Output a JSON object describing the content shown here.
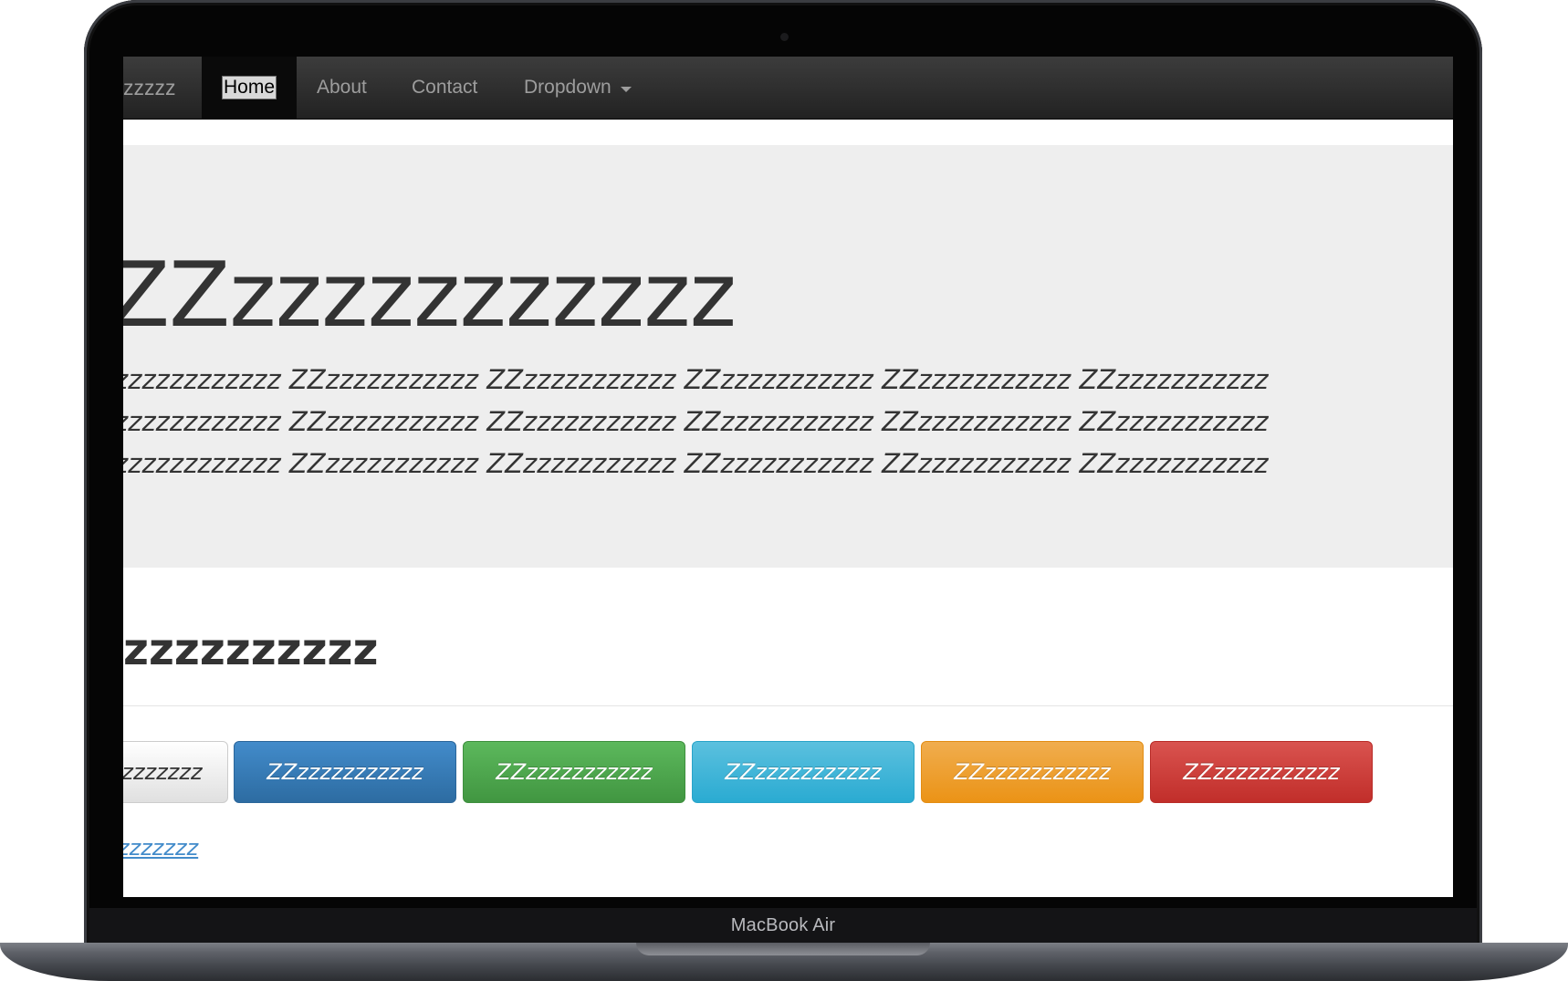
{
  "device": {
    "model_label": "MacBook Air"
  },
  "navbar": {
    "brand": "zzzzz",
    "items": [
      {
        "label": "Home",
        "active": true
      },
      {
        "label": "About"
      },
      {
        "label": "Contact"
      },
      {
        "label": "Dropdown",
        "has_caret": true
      }
    ]
  },
  "jumbotron": {
    "title": "ZZzzzzzzzzzzz",
    "lines": [
      "zzzzzzzzzzzz ZZzzzzzzzzzzz ZZzzzzzzzzzzz ZZzzzzzzzzzzz ZZzzzzzzzzzzz ZZzzzzzzzzzzz",
      "zzzzzzzzzzzz ZZzzzzzzzzzzz ZZzzzzzzzzzzz ZZzzzzzzzzzzz ZZzzzzzzzzzzz ZZzzzzzzzzzzz",
      "zzzzzzzzzzzz ZZzzzzzzzzzzz ZZzzzzzzzzzzz ZZzzzzzzzzzzz ZZzzzzzzzzzzz ZZzzzzzzzzzzz"
    ]
  },
  "section": {
    "heading": "zzzzzzzzzz"
  },
  "buttons": [
    {
      "label": "zzzzzzz",
      "style": "default"
    },
    {
      "label": "ZZzzzzzzzzzzz",
      "style": "primary"
    },
    {
      "label": "ZZzzzzzzzzzzz",
      "style": "success"
    },
    {
      "label": "ZZzzzzzzzzzzz",
      "style": "info"
    },
    {
      "label": "ZZzzzzzzzzzzz",
      "style": "warning"
    },
    {
      "label": "ZZzzzzzzzzzzz",
      "style": "danger"
    }
  ],
  "link": {
    "label": "zzzzzzz"
  },
  "colors": {
    "navbar_bg": "#222222",
    "jumbotron_bg": "#eeeeee",
    "primary": "#428bca",
    "success": "#5cb85c",
    "info": "#5bc0de",
    "warning": "#f0ad4e",
    "danger": "#d9534f",
    "link": "#428bca"
  }
}
